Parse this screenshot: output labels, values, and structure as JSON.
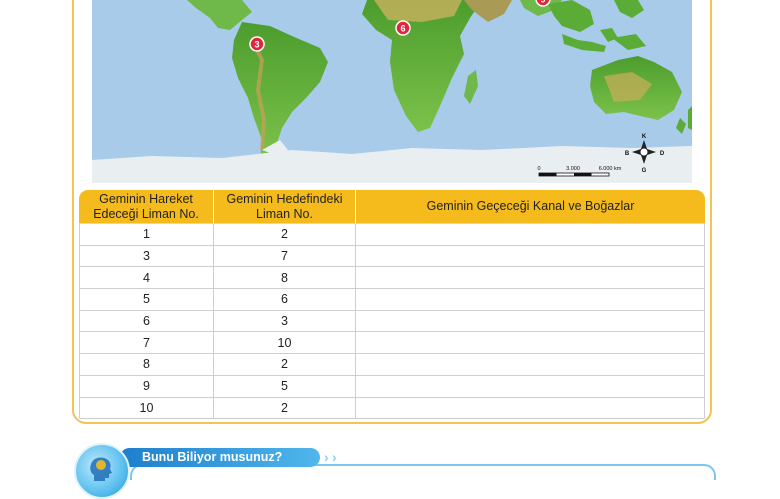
{
  "map": {
    "markers": [
      {
        "label": "3"
      },
      {
        "label": "6"
      },
      {
        "label": "9"
      }
    ],
    "compass": {
      "north": "K",
      "south": "G",
      "east": "D",
      "west": "B"
    },
    "scale": {
      "zero": "0",
      "mid": "3.000",
      "end": "6.000 km"
    },
    "colors": {
      "ocean": "#a7cbe9",
      "land": "#5fb23b",
      "marker": "#e0263b"
    }
  },
  "table": {
    "headers": [
      "Geminin Hareket Edeceği Liman No.",
      "Geminin Hedefindeki Liman No.",
      "Geminin Geçeceği Kanal ve Boğazlar"
    ],
    "rows": [
      [
        "1",
        "2",
        ""
      ],
      [
        "3",
        "7",
        ""
      ],
      [
        "4",
        "8",
        ""
      ],
      [
        "5",
        "6",
        ""
      ],
      [
        "6",
        "3",
        ""
      ],
      [
        "7",
        "10",
        ""
      ],
      [
        "8",
        "2",
        ""
      ],
      [
        "9",
        "5",
        ""
      ],
      [
        "10",
        "2",
        ""
      ]
    ],
    "header_color": "#f5bb1c"
  },
  "tip": {
    "title": "Bunu Biliyor musunuz?",
    "icon": "head-brain-icon"
  }
}
